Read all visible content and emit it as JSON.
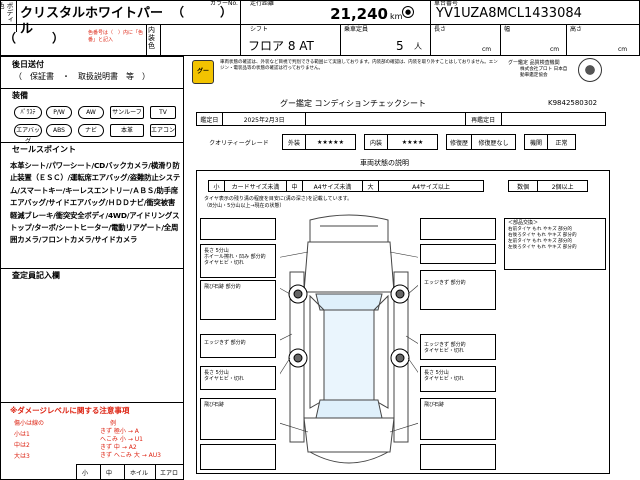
{
  "header": {
    "body_color_label": "ボディ色",
    "color_label": "カラーNo.",
    "color_name": "クリスタルホワイトパール",
    "color_paren": "（　　　）",
    "mileage_label": "走行距離",
    "mileage": "21,240",
    "mileage_unit": "km",
    "chassis_label": "車台番号",
    "chassis": "YV1UZA8MCL1433084",
    "inner_color_label": "内装色",
    "inner_paren": "（　　　）",
    "color_note": "色番号は（　）内に「色番」と記入",
    "shift_label": "シフト",
    "shift": "フロア 8 AT",
    "capacity_label": "乗車定員",
    "capacity": "5",
    "capacity_unit": "人",
    "length_label": "長さ",
    "width_label": "幅",
    "height_label": "高さ",
    "cm": "cm"
  },
  "left": {
    "after_warranty_title": "後日送付",
    "after_warranty_items": "（　保証書　・　取扱説明書　等　）",
    "equipment_title": "装備",
    "equipment": [
      "エアコン",
      "パワステ",
      "パワーウインドウ",
      "サンルーフ",
      "ナビ",
      "エアバッグ",
      "ABS",
      "アルミ",
      "テレビ",
      "本革"
    ],
    "equipment_text": [
      "ﾊﾟﾜｽﾃ",
      "P/W",
      "サンルーフ",
      "TV",
      "エアバッグ",
      "ABS",
      "AW",
      "本革",
      "ナビ",
      "エアコン"
    ],
    "sales_points_title": "セールスポイント",
    "sales_points": "本革シート/パワーシート/CDバックカメラ/横滑り防止装置（ＥＳＣ）/運転席エアバッグ/盗難防止システム/スマートキー/キーレスエントリー/ＡＢＳ/助手席エアバッグ/サイドエアバッグ/ＨＤＤナビ/衝突被害軽減ブレーキ/衝突安全ボディ/4WD/アイドリングストップ/ターボ/シートヒーター/電動リアゲート/全周囲カメラ/フロントカメラ/サイドカメラ",
    "inspector_title": "査定員記入欄",
    "damage_title": "※ダメージレベルに関する注意事項",
    "damage_lines": [
      "傷小は線の",
      "小は1",
      "中は2",
      "大は3"
    ],
    "damage_right": [
      "例",
      "きず 極小 → A",
      "へこみ 小 → U1",
      "きず 中 → A2",
      "きず へこみ 大 → AU3"
    ],
    "bottom_labels": [
      "小",
      "中",
      "ホイル",
      "エアロ"
    ]
  },
  "sheet": {
    "title": "グー鑑定 コンディションチェックシート",
    "sheet_no": "K9842580302",
    "notice": "車両状態の確認は、外装など目視で判別できる範囲にて実施しております。内装部の確認は、内装を取り外すことはしておりません。エンジン・電装品等の状態の確認は行っておりません。",
    "agency": "グー鑑定 品質検査機関",
    "agency_sub": "株式会社プロト 日本自動車鑑定協会",
    "date_label": "鑑定日",
    "date": "2025年2月3日",
    "reappraisal_label": "再鑑定日",
    "quality_label": "クオリティーグレード",
    "exterior_label": "外装",
    "exterior_stars": "★★★★★",
    "interior_label": "内装",
    "interior_stars": "★★★★",
    "repair_label": "修復歴",
    "repair_value": "修復歴なし",
    "engine_label": "機関",
    "engine_value": "正常",
    "condition_title": "車両状態の説明",
    "size_small": "小",
    "size_card": "カードサイズ未満",
    "size_mid": "中",
    "size_a4": "A4サイズ未満",
    "size_big": "大",
    "size_a4plus": "A4サイズ以上",
    "count_label": "数個",
    "count_value": "2個以上",
    "tire_note": "タイヤ表示の残り溝の程度を目安に(溝の深さ)を記載しています。",
    "tire_sub": "（8分山・5分山以上→現在の状態）",
    "parts_note": "＜部品交換＞",
    "panels": [
      {
        "text": "長さ 5分山\nホイール擦れ・凹み 部分的\nタイヤヒビ・切れ"
      },
      {
        "text": "飛び石跡 部分的"
      },
      {
        "text": "エッジきず 部分的"
      },
      {
        "text": "長さ 5分山\nタイヤヒビ・切れ"
      },
      {
        "text": "飛び石跡"
      },
      {
        "text": "エッジきず 部分的"
      },
      {
        "text": "長さ 5分山\nタイヤヒビ・切れ"
      },
      {
        "text": "エッジきず 部分的\nタイヤヒビ・切れ"
      },
      {
        "text": "長さ 5分山\nタイヤヒビ・切れ"
      },
      {
        "text": "飛び石跡"
      },
      {
        "text": "飛び石跡"
      }
    ],
    "right_note": "右前タイヤ もれ やキズ 部分的\n右後ろタイヤ もれ やキズ 部分的\n左前タイヤ もれ やキズ 部分的\n左後ろタイヤ もれ やキズ 部分的"
  }
}
